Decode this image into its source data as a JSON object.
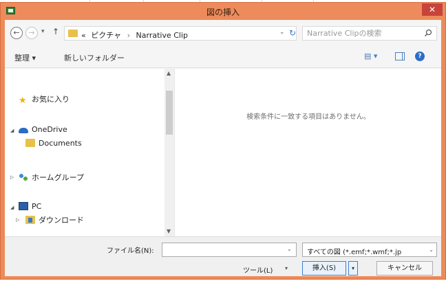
{
  "window": {
    "title": "図の挿入",
    "close_glyph": "✕"
  },
  "nav": {
    "back_glyph": "←",
    "forward_glyph": "→",
    "recent_glyph": "▾",
    "up_glyph": "↑"
  },
  "address": {
    "overflow": "«",
    "crumb1": "ピクチャ",
    "separator": "›",
    "crumb2": "Narrative Clip",
    "dropdown_glyph": "⌄",
    "refresh_glyph": "↻"
  },
  "search": {
    "placeholder": "Narrative Clipの検索"
  },
  "commands": {
    "organize": "整理 ▾",
    "new_folder": "新しいフォルダー",
    "view_glyph": "▤ ▾",
    "help_glyph": "?"
  },
  "sidebar": {
    "items": [
      {
        "label": "お気に入り",
        "expander": ""
      },
      {
        "label": "OneDrive",
        "expander": "◢"
      },
      {
        "label": "Documents",
        "expander": ""
      },
      {
        "label": "ホームグループ",
        "expander": "▷"
      },
      {
        "label": "PC",
        "expander": "◢"
      },
      {
        "label": "ダウンロード",
        "expander": "▷"
      }
    ],
    "scroll_up": "▲",
    "scroll_down": "▼"
  },
  "content": {
    "empty_message": "検索条件に一致する項目はありません。"
  },
  "footer": {
    "filename_label": "ファイル名(N):",
    "filename_value": "",
    "filename_dropdown": "⌄",
    "filetype": "すべての図 (*.emf;*.wmf;*.jp",
    "filetype_arrow": "⌄",
    "tools": "ツール(L)",
    "tools_arrow": "▾",
    "insert": "挿入(S)",
    "insert_arrow": "▾",
    "cancel": "キャンセル"
  },
  "colors": {
    "titlebar": "#ee8b5c",
    "close": "#c7443a",
    "accent": "#3c7fd0"
  }
}
